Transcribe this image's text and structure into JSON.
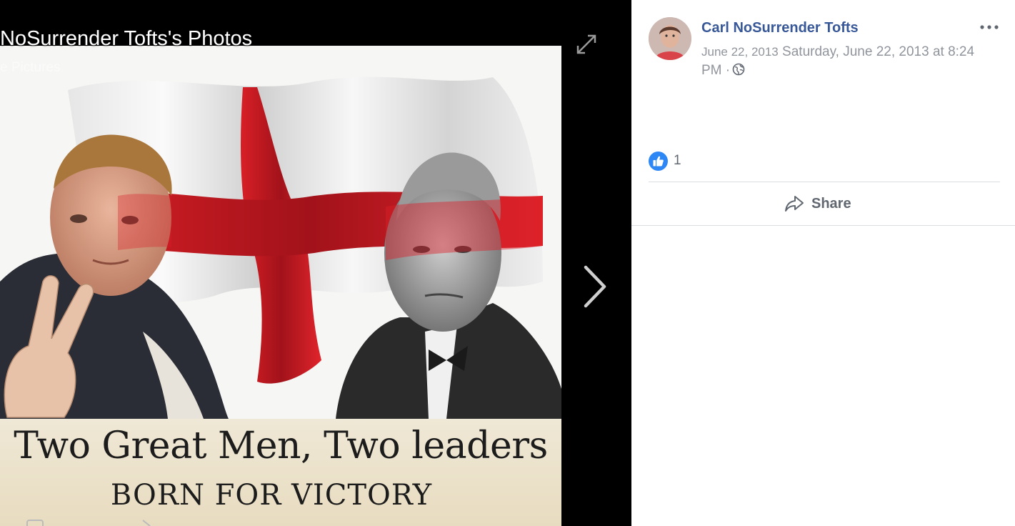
{
  "viewer": {
    "album_title": "NoSurrender Tofts's Photos",
    "album_subtitle": "e Pictures",
    "expand_icon": "expand-icon",
    "next_icon": "chevron-right-icon"
  },
  "photo": {
    "caption_line1": "Two Great Men, Two leaders",
    "caption_line2": "BORN FOR VICTORY",
    "flag_colors": {
      "field": "#f2f2f2",
      "cross": "#cc1d22"
    }
  },
  "post": {
    "author": "Carl NoSurrender Tofts",
    "date_short": "June 22, 2013",
    "date_long": "Saturday, June 22, 2013 at 8:24 PM",
    "separator": "·",
    "audience_icon": "globe-icon",
    "more_icon": "more-options-icon",
    "reaction_icon": "like-icon",
    "reaction_count": "1",
    "share_label": "Share",
    "share_icon": "share-icon"
  },
  "colors": {
    "link": "#385898",
    "meta": "#90949c",
    "like": "#2d87f4",
    "divider": "#dadde1"
  }
}
